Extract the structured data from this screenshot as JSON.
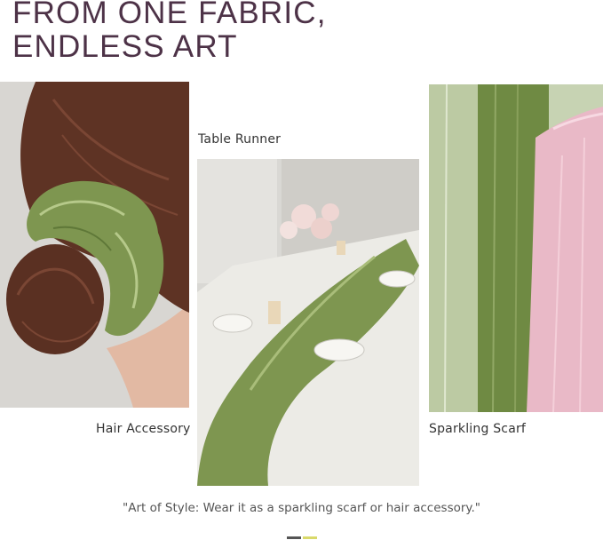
{
  "headline": {
    "line1": "FROM ONE FABRIC,",
    "line2": "ENDLESS ART"
  },
  "panels": {
    "hair": {
      "caption": "Hair Accessory"
    },
    "runner": {
      "caption": "Table Runner"
    },
    "scarf": {
      "caption": "Sparkling Scarf"
    }
  },
  "quote": "\"Art of Style: Wear it as a sparkling scarf or hair accessory.\"",
  "colors": {
    "headline": "#4d3247",
    "sage": "#7e9650",
    "pink": "#e8b9c6",
    "dot_active": "#555555",
    "dot_inactive": "#d9d96a"
  }
}
